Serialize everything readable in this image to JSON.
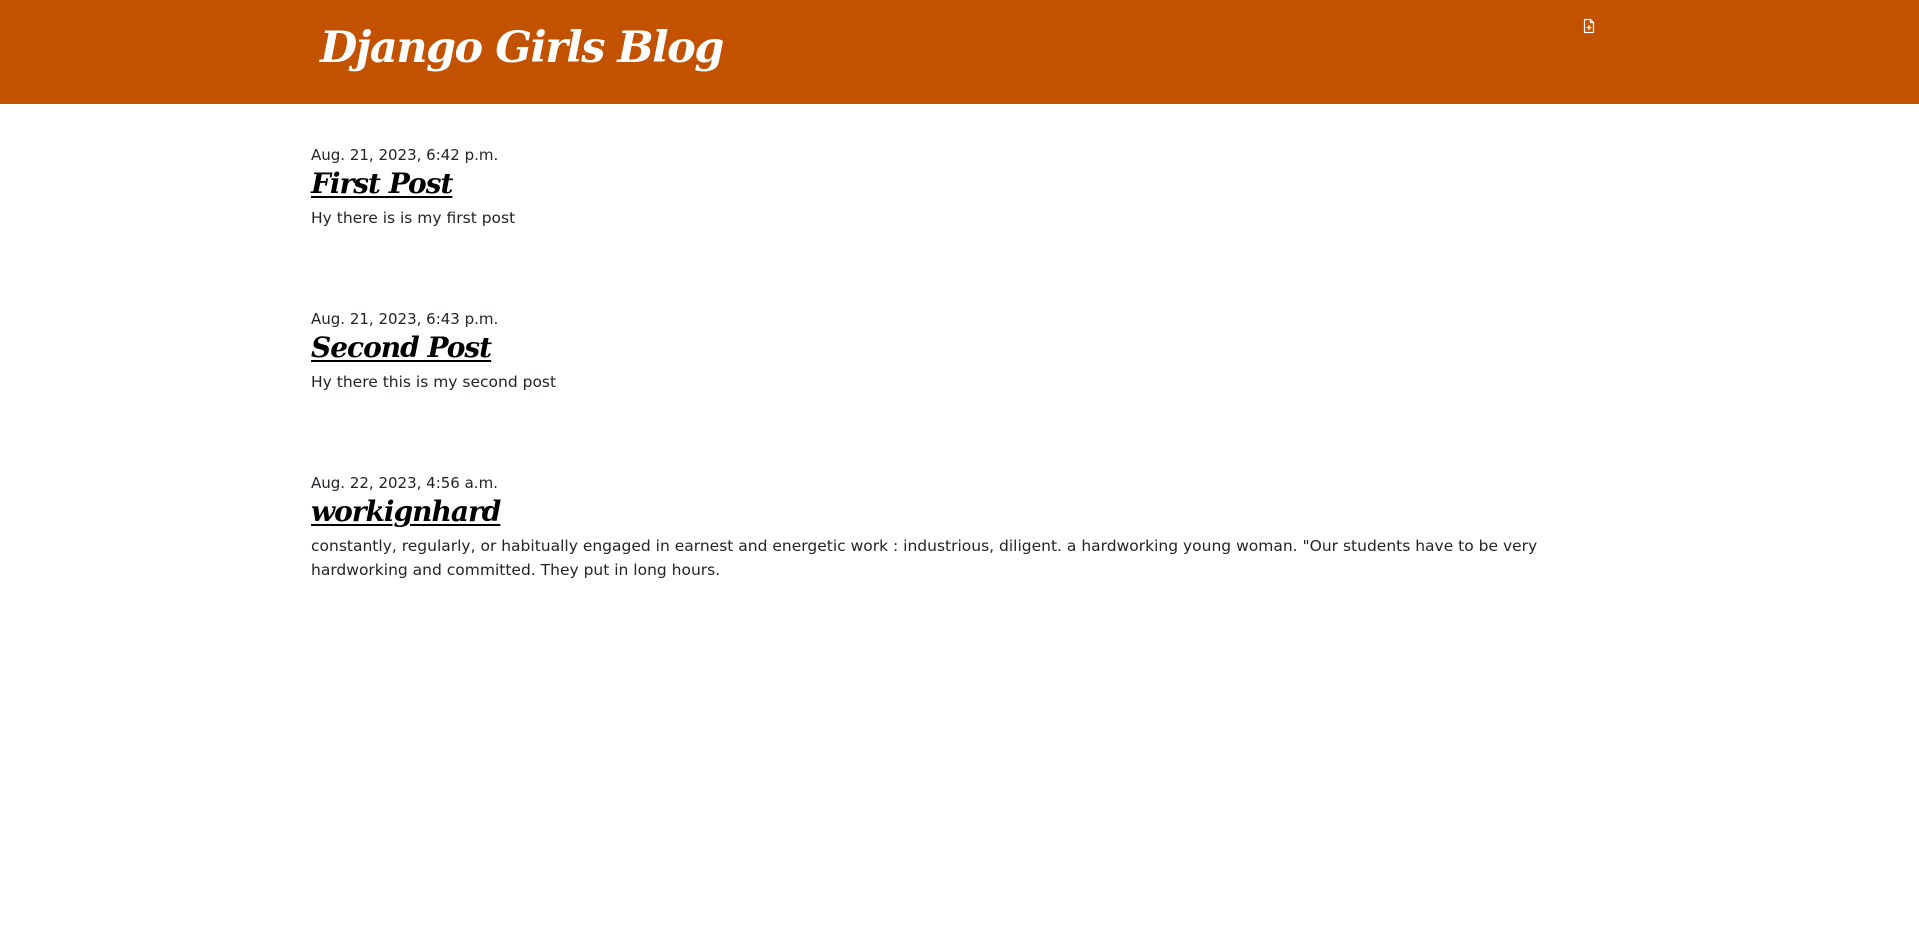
{
  "header": {
    "site_title": "Django Girls Blog",
    "new_post_icon": "file-plus-icon"
  },
  "colors": {
    "header_background": "#c25100",
    "header_text": "#ffffff",
    "body_text": "#212529",
    "post_title": "#000000"
  },
  "posts": [
    {
      "date": "Aug. 21, 2023, 6:42 p.m.",
      "title": "First Post",
      "text": "Hy there is is my first post"
    },
    {
      "date": "Aug. 21, 2023, 6:43 p.m.",
      "title": "Second Post",
      "text": "Hy there this is my second post"
    },
    {
      "date": "Aug. 22, 2023, 4:56 a.m.",
      "title": "workignhard",
      "text": "constantly, regularly, or habitually engaged in earnest and energetic work : industrious, diligent. a hardworking young woman. \"Our students have to be very hardworking and committed. They put in long hours."
    }
  ]
}
